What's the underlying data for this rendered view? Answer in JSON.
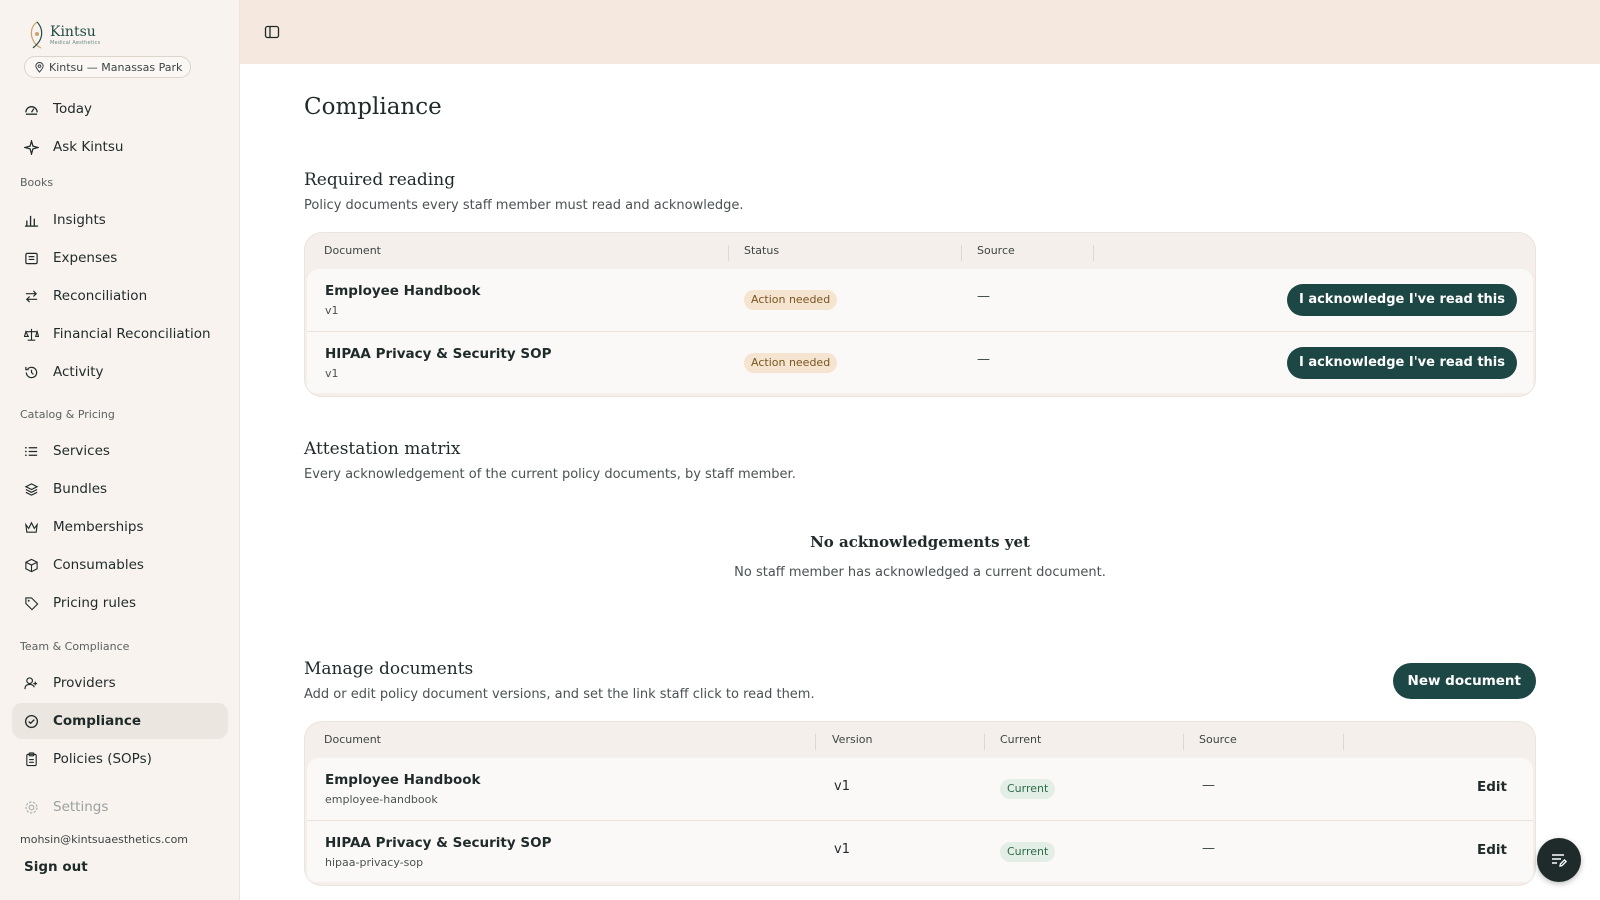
{
  "brand": {
    "name": "Kintsu",
    "sub": "Medical Aesthetics"
  },
  "location": "Kintsu — Manassas Park",
  "nav": {
    "today": "Today",
    "ask": "Ask Kintsu",
    "group_books": "Books",
    "insights": "Insights",
    "expenses": "Expenses",
    "reconciliation": "Reconciliation",
    "financial_reconciliation": "Financial Reconciliation",
    "activity": "Activity",
    "group_catalog": "Catalog & Pricing",
    "services": "Services",
    "bundles": "Bundles",
    "memberships": "Memberships",
    "consumables": "Consumables",
    "pricing_rules": "Pricing rules",
    "group_team": "Team & Compliance",
    "providers": "Providers",
    "compliance": "Compliance",
    "policies": "Policies (SOPs)",
    "settings": "Settings"
  },
  "user": {
    "email": "mohsin@kintsuaesthetics.com",
    "sign_out": "Sign out"
  },
  "page": {
    "title": "Compliance"
  },
  "required": {
    "title": "Required reading",
    "desc": "Policy documents every staff member must read and acknowledge.",
    "columns": {
      "document": "Document",
      "status": "Status",
      "source": "Source"
    },
    "rows": [
      {
        "title": "Employee Handbook",
        "version": "v1",
        "status": "Action needed",
        "source": "—",
        "action": "I acknowledge I've read this"
      },
      {
        "title": "HIPAA Privacy & Security SOP",
        "version": "v1",
        "status": "Action needed",
        "source": "—",
        "action": "I acknowledge I've read this"
      }
    ]
  },
  "matrix": {
    "title": "Attestation matrix",
    "desc": "Every acknowledgement of the current policy documents, by staff member.",
    "empty_title": "No acknowledgements yet",
    "empty_desc": "No staff member has acknowledged a current document."
  },
  "manage": {
    "title": "Manage documents",
    "desc": "Add or edit policy document versions, and set the link staff click to read them.",
    "new_button": "New document",
    "columns": {
      "document": "Document",
      "version": "Version",
      "current": "Current",
      "source": "Source"
    },
    "rows": [
      {
        "title": "Employee Handbook",
        "slug": "employee-handbook",
        "version": "v1",
        "current": "Current",
        "source": "—",
        "action": "Edit"
      },
      {
        "title": "HIPAA Privacy & Security SOP",
        "slug": "hipaa-privacy-sop",
        "version": "v1",
        "current": "Current",
        "source": "—",
        "action": "Edit"
      }
    ]
  },
  "colors": {
    "accent": "#1d4744",
    "sidebar_bg": "#f8f3ef",
    "topbar_bg": "#f4e8df",
    "warn_badge": "#f4e4d0",
    "ok_badge": "#e3efe6"
  }
}
